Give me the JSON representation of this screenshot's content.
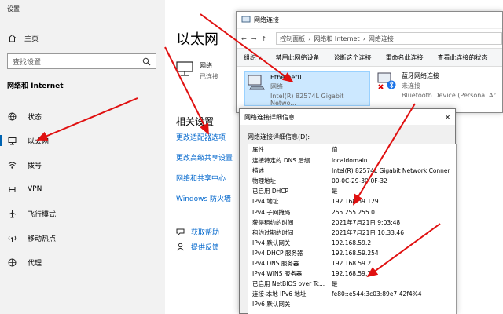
{
  "settings": {
    "window_title": "设置",
    "home_label": "主页",
    "search_placeholder": "查找设置",
    "section_header": "网络和 Internet",
    "nav": [
      {
        "label": "状态",
        "icon": "status-globe-icon"
      },
      {
        "label": "以太网",
        "icon": "ethernet-icon",
        "selected": true
      },
      {
        "label": "拨号",
        "icon": "dialup-icon"
      },
      {
        "label": "VPN",
        "icon": "vpn-icon"
      },
      {
        "label": "飞行模式",
        "icon": "airplane-icon"
      },
      {
        "label": "移动热点",
        "icon": "hotspot-icon"
      },
      {
        "label": "代理",
        "icon": "proxy-globe-icon"
      }
    ],
    "page_title": "以太网",
    "network_name": "网络",
    "network_status": "已连接",
    "related_title": "相关设置",
    "related_links": [
      "更改适配器选项",
      "更改高级共享设置",
      "网络和共享中心",
      "Windows 防火墙"
    ],
    "help": [
      "获取帮助",
      "提供反馈"
    ]
  },
  "network_connections": {
    "window_title": "网络连接",
    "breadcrumb": [
      "控制面板",
      "网络和 Internet",
      "网络连接"
    ],
    "toolbar": [
      "组织 ▾",
      "禁用此网络设备",
      "诊断这个连接",
      "重命名此连接",
      "查看此连接的状态"
    ],
    "adapters": [
      {
        "name": "Ethernet0",
        "status": "网络",
        "device": "Intel(R) 82574L Gigabit Netwo..."
      },
      {
        "name": "蓝牙网络连接",
        "status": "未连接",
        "device": "Bluetooth Device (Personal Ar..."
      }
    ]
  },
  "details_dialog": {
    "title": "网络连接详细信息",
    "caption": "网络连接详细信息(D):",
    "col_property": "属性",
    "col_value": "值",
    "rows": [
      {
        "k": "连接特定的 DNS 后缀",
        "v": "localdomain"
      },
      {
        "k": "描述",
        "v": "Intel(R) 82574L Gigabit Network Conner"
      },
      {
        "k": "物理地址",
        "v": "00-0C-29-30-0F-32"
      },
      {
        "k": "已启用 DHCP",
        "v": "是"
      },
      {
        "k": "IPv4 地址",
        "v": "192.168.59.129"
      },
      {
        "k": "IPv4 子网掩码",
        "v": "255.255.255.0"
      },
      {
        "k": "获得租约的时间",
        "v": "2021年7月21日 9:03:48"
      },
      {
        "k": "租约过期的时间",
        "v": "2021年7月21日 10:33:46"
      },
      {
        "k": "IPv4 默认网关",
        "v": "192.168.59.2"
      },
      {
        "k": "IPv4 DHCP 服务器",
        "v": "192.168.59.254"
      },
      {
        "k": "IPv4 DNS 服务器",
        "v": "192.168.59.2"
      },
      {
        "k": "IPv4 WINS 服务器",
        "v": "192.168.59.2"
      },
      {
        "k": "已启用 NetBIOS over Tc...",
        "v": "是"
      },
      {
        "k": "连接-本地 IPv6 地址",
        "v": "fe80::e544:3c03:89e7:42f4%4"
      },
      {
        "k": "IPv6 默认网关",
        "v": ""
      }
    ]
  },
  "colors": {
    "accent": "#0063b1",
    "link": "#0066cc",
    "arrow": "#e01010",
    "selected_bg": "#cce8ff"
  }
}
